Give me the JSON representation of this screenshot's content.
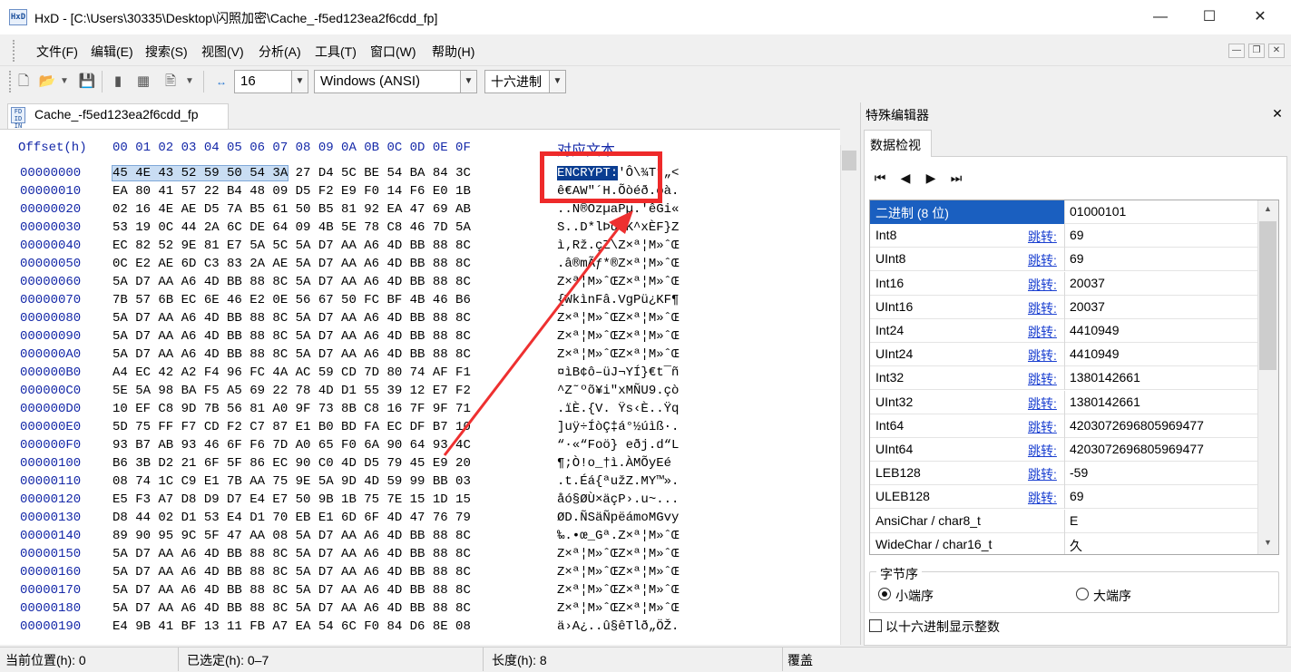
{
  "window": {
    "app_icon": "HxD",
    "title": "HxD - [C:\\Users\\30335\\Desktop\\闪照加密\\Cache_-f5ed123ea2f6cdd_fp]",
    "minimize": "—",
    "maximize": "☐",
    "close": "✕"
  },
  "menu": [
    "文件(F)",
    "编辑(E)",
    "搜索(S)",
    "视图(V)",
    "分析(A)",
    "工具(T)",
    "窗口(W)",
    "帮助(H)"
  ],
  "toolbar": {
    "bytes_per_row": "16",
    "charset": "Windows (ANSI)",
    "offset_base": "十六进制"
  },
  "tab": {
    "label": "Cache_-f5ed123ea2f6cdd_fp"
  },
  "hex": {
    "header_offset": "Offset(h)",
    "header_cols": "00 01 02 03 04 05 06 07 08 09 0A 0B 0C 0D 0E 0F",
    "header_text": "对应文本",
    "rows": [
      {
        "off": "00000000",
        "bytes": "45 4E 43 52 59 50 54 3A 27 D4 5C BE 54 BA 84 3C",
        "text": "ENCRYPT:'Ô\\¾Tº„<"
      },
      {
        "off": "00000010",
        "bytes": "EA 80 41 57 22 B4 48 09 D5 F2 E9 F0 14 F6 E0 1B",
        "text": "ê€AW\"´H.Õòéð.öà."
      },
      {
        "off": "00000020",
        "bytes": "02 16 4E AE D5 7A B5 61 50 B5 81 92 EA 47 69 AB",
        "text": "..N®ÕzµaPµ.'êGi«"
      },
      {
        "off": "00000030",
        "bytes": "53 19 0C 44 2A 6C DE 64 09 4B 5E 78 C8 46 7D 5A",
        "text": "S..D*lÞd.K^xÈF}Z"
      },
      {
        "off": "00000040",
        "bytes": "EC 82 52 9E 81 E7 5A 5C 5A D7 AA A6 4D BB 88 8C",
        "text": "ì‚Rž.çZ\\Z×ª¦M»ˆŒ"
      },
      {
        "off": "00000050",
        "bytes": "0C E2 AE 6D C3 83 2A AE 5A D7 AA A6 4D BB 88 8C",
        "text": ".â®mÃƒ*®Z×ª¦M»ˆŒ"
      },
      {
        "off": "00000060",
        "bytes": "5A D7 AA A6 4D BB 88 8C 5A D7 AA A6 4D BB 88 8C",
        "text": "Z×ª¦M»ˆŒZ×ª¦M»ˆŒ"
      },
      {
        "off": "00000070",
        "bytes": "7B 57 6B EC 6E 46 E2 0E 56 67 50 FC BF 4B 46 B6",
        "text": "{WkìnFâ.VgPü¿KF¶"
      },
      {
        "off": "00000080",
        "bytes": "5A D7 AA A6 4D BB 88 8C 5A D7 AA A6 4D BB 88 8C",
        "text": "Z×ª¦M»ˆŒZ×ª¦M»ˆŒ"
      },
      {
        "off": "00000090",
        "bytes": "5A D7 AA A6 4D BB 88 8C 5A D7 AA A6 4D BB 88 8C",
        "text": "Z×ª¦M»ˆŒZ×ª¦M»ˆŒ"
      },
      {
        "off": "000000A0",
        "bytes": "5A D7 AA A6 4D BB 88 8C 5A D7 AA A6 4D BB 88 8C",
        "text": "Z×ª¦M»ˆŒZ×ª¦M»ˆŒ"
      },
      {
        "off": "000000B0",
        "bytes": "A4 EC 42 A2 F4 96 FC 4A AC 59 CD 7D 80 74 AF F1",
        "text": "¤ìB¢ô–üJ¬YÍ}€t¯ñ"
      },
      {
        "off": "000000C0",
        "bytes": "5E 5A 98 BA F5 A5 69 22 78 4D D1 55 39 12 E7 F2",
        "text": "^Z˜ºõ¥i\"xMÑU9.çò"
      },
      {
        "off": "000000D0",
        "bytes": "10 EF C8 9D 7B 56 81 A0 9F 73 8B C8 16 7F 9F 71",
        "text": ".ïÈ.{V. Ÿs‹È..Ÿq"
      },
      {
        "off": "000000E0",
        "bytes": "5D 75 FF F7 CD F2 C7 87 E1 B0 BD FA EC DF B7 10",
        "text": "]uÿ÷ÍòÇ‡á°½úìß·."
      },
      {
        "off": "000000F0",
        "bytes": "93 B7 AB 93 46 6F F6 7D A0 65 F0 6A 90 64 93 4C",
        "text": "“·«“Foö} eðj.d“L"
      },
      {
        "off": "00000100",
        "bytes": "B6 3B D2 21 6F 5F 86 EC 90 C0 4D D5 79 45 E9 20",
        "text": "¶;Ò!o_†ì.ÀMÕyEé "
      },
      {
        "off": "00000110",
        "bytes": "08 74 1C C9 E1 7B AA 75 9E 5A 9D 4D 59 99 BB 03",
        "text": ".t.Éá{ªužZ.MY™»."
      },
      {
        "off": "00000120",
        "bytes": "E5 F3 A7 D8 D9 D7 E4 E7 50 9B 1B 75 7E 15 1D 15",
        "text": "åó§ØÙ×äçP›.u~..."
      },
      {
        "off": "00000130",
        "bytes": "D8 44 02 D1 53 E4 D1 70 EB E1 6D 6F 4D 47 76 79",
        "text": "ØD.ÑSäÑpëámoMGvy"
      },
      {
        "off": "00000140",
        "bytes": "89 90 95 9C 5F 47 AA 08 5A D7 AA A6 4D BB 88 8C",
        "text": "‰.•œ_Gª.Z×ª¦M»ˆŒ"
      },
      {
        "off": "00000150",
        "bytes": "5A D7 AA A6 4D BB 88 8C 5A D7 AA A6 4D BB 88 8C",
        "text": "Z×ª¦M»ˆŒZ×ª¦M»ˆŒ"
      },
      {
        "off": "00000160",
        "bytes": "5A D7 AA A6 4D BB 88 8C 5A D7 AA A6 4D BB 88 8C",
        "text": "Z×ª¦M»ˆŒZ×ª¦M»ˆŒ"
      },
      {
        "off": "00000170",
        "bytes": "5A D7 AA A6 4D BB 88 8C 5A D7 AA A6 4D BB 88 8C",
        "text": "Z×ª¦M»ˆŒZ×ª¦M»ˆŒ"
      },
      {
        "off": "00000180",
        "bytes": "5A D7 AA A6 4D BB 88 8C 5A D7 AA A6 4D BB 88 8C",
        "text": "Z×ª¦M»ˆŒZ×ª¦M»ˆŒ"
      },
      {
        "off": "00000190",
        "bytes": "E4 9B 41 BF 13 11 FB A7 EA 54 6C F0 84 D6 8E 08",
        "text": "ä›A¿..û§êTlð„ÖŽ."
      }
    ]
  },
  "panel": {
    "title": "特殊编辑器",
    "close": "✕",
    "tab": "数据检视",
    "nav": [
      "⏮",
      "◀",
      "▶",
      "⏭"
    ],
    "jump_label": "跳转:",
    "rows": [
      {
        "name": "二进制 (8 位)",
        "value": "01000101",
        "jump": false
      },
      {
        "name": "Int8",
        "value": "69",
        "jump": true
      },
      {
        "name": "UInt8",
        "value": "69",
        "jump": true
      },
      {
        "name": "Int16",
        "value": "20037",
        "jump": true
      },
      {
        "name": "UInt16",
        "value": "20037",
        "jump": true
      },
      {
        "name": "Int24",
        "value": "4410949",
        "jump": true
      },
      {
        "name": "UInt24",
        "value": "4410949",
        "jump": true
      },
      {
        "name": "Int32",
        "value": "1380142661",
        "jump": true
      },
      {
        "name": "UInt32",
        "value": "1380142661",
        "jump": true
      },
      {
        "name": "Int64",
        "value": "4203072696805969477",
        "jump": true
      },
      {
        "name": "UInt64",
        "value": "4203072696805969477",
        "jump": true
      },
      {
        "name": "LEB128",
        "value": "-59",
        "jump": true
      },
      {
        "name": "ULEB128",
        "value": "69",
        "jump": true
      },
      {
        "name": "AnsiChar / char8_t",
        "value": "E",
        "jump": false
      },
      {
        "name": "WideChar / char16_t",
        "value": "久",
        "jump": false
      }
    ],
    "byte_order_label": "字节序",
    "little_endian": "小端序",
    "big_endian": "大端序",
    "hex_ints_label": "以十六进制显示整数"
  },
  "status": {
    "position": "当前位置(h): 0",
    "selected": "已选定(h): 0–7",
    "length": "长度(h): 8",
    "mode": "覆盖"
  },
  "colors": {
    "accent": "#1a5fc0",
    "annotation": "#ee2a2a",
    "offset_text": "#1428a8"
  }
}
